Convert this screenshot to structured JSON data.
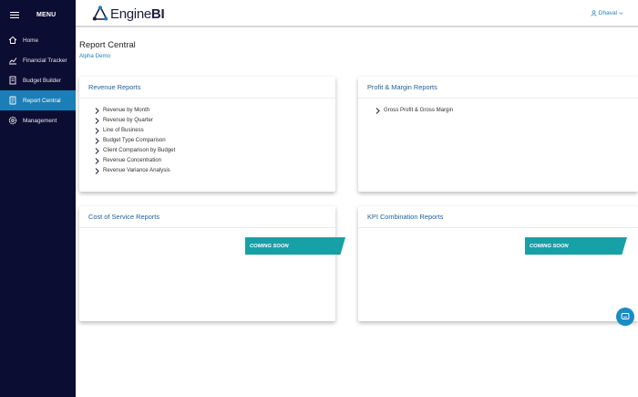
{
  "sidebar": {
    "menu_label": "MENU",
    "items": [
      {
        "label": "Home",
        "icon": "home-icon"
      },
      {
        "label": "Financial Tracker",
        "icon": "chart-icon"
      },
      {
        "label": "Budget Builder",
        "icon": "document-icon"
      },
      {
        "label": "Report Central",
        "icon": "report-icon",
        "active": true
      },
      {
        "label": "Management",
        "icon": "gear-icon"
      }
    ]
  },
  "header": {
    "logo_engine": "Engine",
    "logo_bi": "BI",
    "user_name": "Dhaval"
  },
  "page": {
    "title": "Report Central",
    "subtitle": "Alpha Demo"
  },
  "cards": {
    "revenue": {
      "title": "Revenue Reports",
      "items": [
        "Revenue by Month",
        "Revenue by Quarter",
        "Line of Business",
        "Budget Type Comparison",
        "Client Comparison by Budget",
        "Revenue Concentration",
        "Revenue Variance Analysis"
      ]
    },
    "profit": {
      "title": "Profit & Margin Reports",
      "items": [
        "Gross Profit & Gross Margin"
      ]
    },
    "cost": {
      "title": "Cost of Service Reports",
      "ribbon": "COMING SOON"
    },
    "kpi": {
      "title": "KPI Combination Reports",
      "ribbon": "COMING SOON"
    }
  },
  "colors": {
    "sidebar_bg": "#0c0d33",
    "accent": "#1a7fb8",
    "ribbon": "#17a0a5"
  }
}
